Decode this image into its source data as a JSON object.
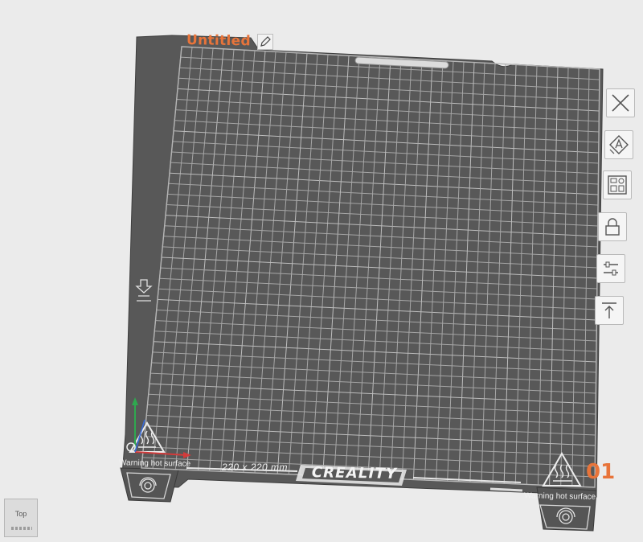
{
  "plate": {
    "title": "Untitled",
    "number": "01",
    "size_label": "220 x 220  mm",
    "brand": "CREALITY",
    "warning_left": "Warning hot surface",
    "warning_right": "Warning hot surface"
  },
  "toolbar": {
    "items": [
      {
        "name": "delete-plate-button",
        "icon": "close-icon"
      },
      {
        "name": "auto-orient-button",
        "icon": "orient-icon"
      },
      {
        "name": "arrange-button",
        "icon": "arrange-icon"
      },
      {
        "name": "lock-button",
        "icon": "lock-icon"
      },
      {
        "name": "plate-settings-button",
        "icon": "sliders-icon"
      },
      {
        "name": "move-to-top-button",
        "icon": "arrow-up-icon"
      }
    ]
  },
  "viewcube": {
    "face_label": "Top"
  },
  "colors": {
    "background": "#ebebeb",
    "plate": "#585858",
    "grid": "#a8a8a8",
    "accent": "#e8743a"
  }
}
